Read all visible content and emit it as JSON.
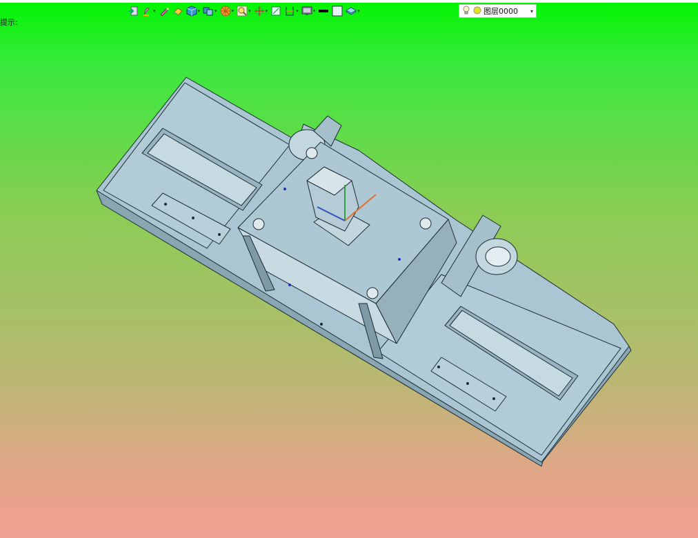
{
  "window": {
    "hint_label": "提示:"
  },
  "toolbar": {
    "items": [
      {
        "icon": "import-icon"
      },
      {
        "icon": "pen-icon",
        "dropdown": true
      },
      {
        "icon": "pencil-icon"
      },
      {
        "icon": "eraser-icon"
      },
      {
        "icon": "cube-icon",
        "dropdown": true
      },
      {
        "icon": "view-cube-icon",
        "dropdown": true
      },
      {
        "icon": "render-sphere-icon",
        "dropdown": true
      },
      {
        "icon": "zoom-icon",
        "dropdown": true
      },
      {
        "icon": "pan-icon",
        "dropdown": true
      },
      {
        "icon": "fit-view-icon"
      },
      {
        "icon": "section-icon",
        "dropdown": true
      },
      {
        "icon": "monitor-icon",
        "dropdown": true
      },
      {
        "icon": "line-weight-icon"
      },
      {
        "icon": "color-swatch-icon"
      },
      {
        "icon": "layer-stack-icon",
        "dropdown": true
      }
    ],
    "layer_select": {
      "value": "图层0000"
    }
  },
  "colors": {
    "bg_top": "#00f500",
    "bg_bottom": "#f0a090",
    "model_face": "#a8c8d4",
    "model_edge": "#1a2a33"
  }
}
